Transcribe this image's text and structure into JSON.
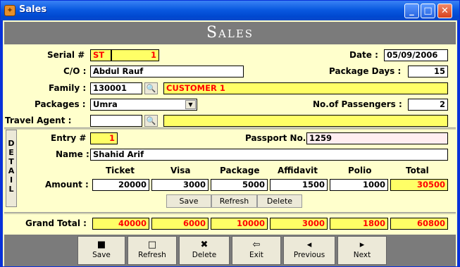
{
  "window": {
    "title": "Sales",
    "icon": "app-icon"
  },
  "banner": "Sales",
  "serial": {
    "label": "Serial #",
    "prefix": "ST",
    "value": "1"
  },
  "date": {
    "label": "Date :",
    "value": "05/09/2006"
  },
  "co": {
    "label": "C/O :",
    "value": "Abdul Rauf"
  },
  "package_days": {
    "label": "Package Days :",
    "value": "15"
  },
  "family": {
    "label": "Family :",
    "code": "130001",
    "name": "CUSTOMER 1"
  },
  "packages": {
    "label": "Packages :",
    "value": "Umra"
  },
  "passengers": {
    "label": "No.of Passengers :",
    "value": "2"
  },
  "travel_agent": {
    "label": "Travel Agent :",
    "code": "",
    "name": ""
  },
  "detail_tab": [
    "D",
    "E",
    "T",
    "A",
    "I",
    "L"
  ],
  "entry": {
    "label": "Entry #",
    "value": "1"
  },
  "passport": {
    "label": "Passport No.",
    "value": "1259"
  },
  "name": {
    "label": "Name :",
    "value": "Shahid Arif"
  },
  "columns": [
    "Ticket",
    "Visa",
    "Package",
    "Affidavit",
    "Polio",
    "Total"
  ],
  "amount": {
    "label": "Amount :",
    "values": [
      "20000",
      "3000",
      "5000",
      "1500",
      "1000",
      "30500"
    ]
  },
  "detail_buttons": {
    "save": "Save",
    "refresh": "Refresh",
    "delete": "Delete"
  },
  "grand_total": {
    "label": "Grand Total :",
    "values": [
      "40000",
      "6000",
      "10000",
      "3000",
      "1800",
      "60800"
    ]
  },
  "footer": {
    "save": "Save",
    "refresh": "Refresh",
    "delete": "Delete",
    "exit": "Exit",
    "previous": "Previous",
    "next": "Next"
  },
  "colors": {
    "title_bar": "#0a5ae0",
    "banner": "#7b7b7b",
    "form_bg": "#ffffcc",
    "highlight": "#ffff66",
    "red_text": "#ff0000"
  }
}
